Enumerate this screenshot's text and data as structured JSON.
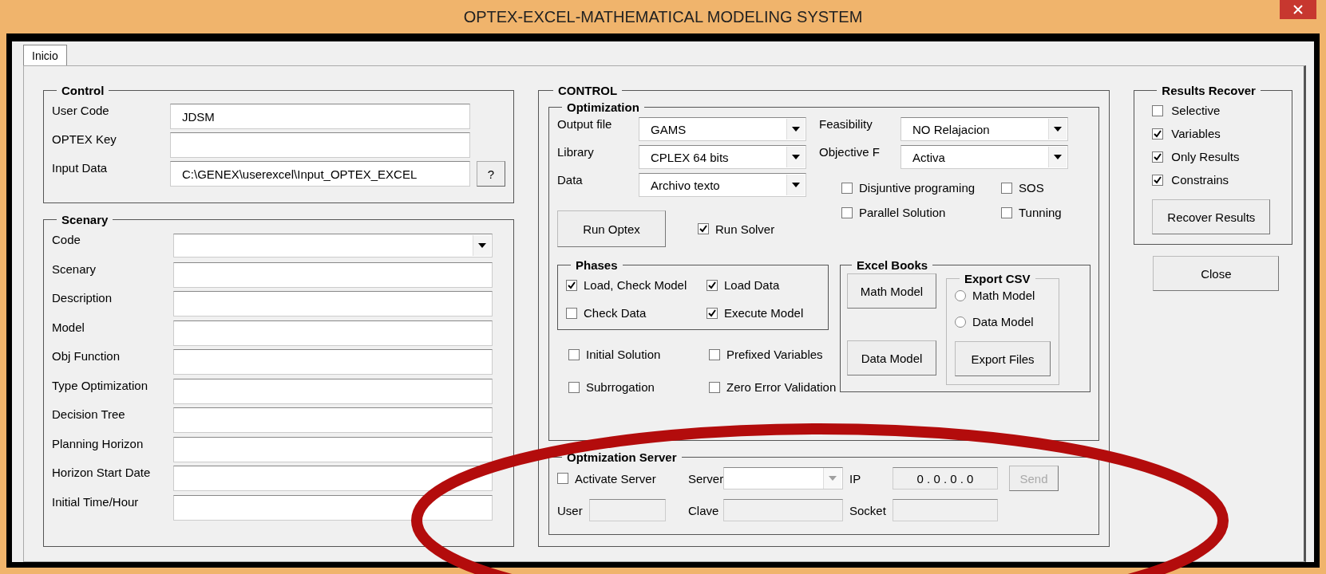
{
  "window": {
    "title": "OPTEX-EXCEL-MATHEMATICAL MODELING SYSTEM"
  },
  "tabs": [
    {
      "label": "Inicio",
      "selected": true
    }
  ],
  "control": {
    "title": "Control",
    "fields": [
      {
        "label": "User Code",
        "value": "JDSM"
      },
      {
        "label": "OPTEX Key"
      },
      {
        "label": "Input Data",
        "value": "C:\\GENEX\\userexcel\\Input_OPTEX_EXCEL",
        "button": "?"
      }
    ]
  },
  "scenary": {
    "title": "Scenary",
    "fields": [
      {
        "label": "Code",
        "kind": "dropdown"
      },
      {
        "label": "Scenary",
        "kind": "text"
      },
      {
        "label": "Description",
        "kind": "text"
      },
      {
        "label": "Model",
        "kind": "text"
      },
      {
        "label": "Obj Function",
        "kind": "text"
      },
      {
        "label": "Type Optimization",
        "kind": "text"
      },
      {
        "label": "Decision Tree",
        "kind": "text"
      },
      {
        "label": "Planning Horizon",
        "kind": "text"
      },
      {
        "label": "Horizon Start Date",
        "kind": "text"
      },
      {
        "label": "Initial Time/Hour",
        "kind": "text"
      }
    ]
  },
  "main": {
    "title": "CONTROL",
    "optimization": {
      "title": "Optimization",
      "dropdowns_left": [
        {
          "label": "Output file",
          "value": "GAMS"
        },
        {
          "label": "Library",
          "value": "CPLEX 64 bits"
        },
        {
          "label": "Data",
          "value": "Archivo texto"
        }
      ],
      "dropdowns_right": [
        {
          "label": "Feasibility",
          "value": "NO Relajacion"
        },
        {
          "label": "Objective F",
          "value": "Activa"
        }
      ],
      "options": [
        {
          "label": "Disjuntive programing",
          "checked": false
        },
        {
          "label": "SOS",
          "checked": false
        },
        {
          "label": "Parallel Solution",
          "checked": false
        },
        {
          "label": "Tunning",
          "checked": false
        }
      ],
      "run_button": "Run Optex",
      "run_solver": {
        "label": "Run Solver",
        "checked": true
      },
      "phases": {
        "title": "Phases",
        "items": [
          {
            "label": "Load, Check Model",
            "checked": true
          },
          {
            "label": "Load Data",
            "checked": true
          },
          {
            "label": "Check Data",
            "checked": false
          },
          {
            "label": "Execute Model",
            "checked": true
          }
        ]
      },
      "extra_options": [
        {
          "label": "Initial Solution",
          "checked": false
        },
        {
          "label": "Prefixed Variables",
          "checked": false
        },
        {
          "label": "Subrrogation",
          "checked": false
        },
        {
          "label": "Zero Error Validation",
          "checked": false
        }
      ],
      "excel_books": {
        "title": "Excel Books",
        "buttons": [
          "Math Model",
          "Data Model"
        ]
      },
      "export_csv": {
        "title": "Export CSV",
        "options": [
          {
            "label": "Math Model",
            "selected": false
          },
          {
            "label": "Data Model",
            "selected": false
          }
        ],
        "button": "Export Files"
      }
    },
    "server": {
      "title": "Optmization Server",
      "activate": {
        "label": "Activate Server",
        "checked": false
      },
      "server_label": "Server",
      "user_label": "User",
      "clave_label": "Clave",
      "ip_label": "IP",
      "ip_value": "0 . 0 . 0 . 0",
      "socket_label": "Socket",
      "send_button": {
        "label": "Send",
        "disabled": true
      }
    }
  },
  "results": {
    "title": "Results Recover",
    "items": [
      {
        "label": "Selective",
        "checked": false
      },
      {
        "label": "Variables",
        "checked": true
      },
      {
        "label": "Only Results",
        "checked": true
      },
      {
        "label": "Constrains",
        "checked": true
      }
    ],
    "button": "Recover Results"
  },
  "close_button": "Close"
}
